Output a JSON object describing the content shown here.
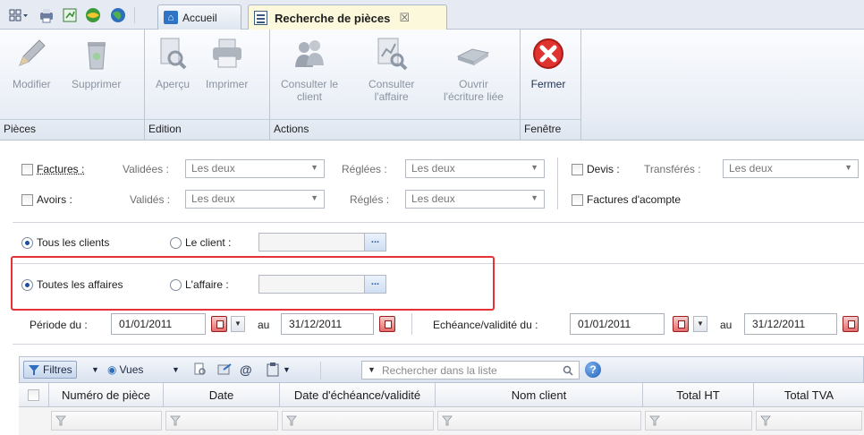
{
  "tabs": {
    "home_label": "Accueil",
    "active_label": "Recherche de pièces",
    "close_symbol": "☒"
  },
  "ribbon": {
    "groups": {
      "pieces": "Pièces",
      "edition": "Edition",
      "actions": "Actions",
      "fenetre": "Fenêtre"
    },
    "buttons": {
      "modifier": "Modifier",
      "supprimer": "Supprimer",
      "apercu": "Aperçu",
      "imprimer": "Imprimer",
      "consulter_client_1": "Consulter le",
      "consulter_client_2": "client",
      "consulter_affaire_1": "Consulter",
      "consulter_affaire_2": "l'affaire",
      "ouvrir_ecriture_1": "Ouvrir",
      "ouvrir_ecriture_2": "l'écriture liée",
      "fermer": "Fermer"
    }
  },
  "filters": {
    "factures": "Factures :",
    "avoirs": "Avoirs :",
    "validees": "Validées :",
    "valides": "Validés :",
    "reglees": "Réglées :",
    "regles": "Réglés :",
    "les_deux": "Les deux",
    "devis": "Devis :",
    "transferes": "Transférés :",
    "factures_acompte": "Factures d'acompte"
  },
  "clients": {
    "tous_clients": "Tous les clients",
    "le_client": "Le client :",
    "toutes_affaires": "Toutes les affaires",
    "l_affaire": "L'affaire :",
    "lookup_btn": "..."
  },
  "periode": {
    "label": "Période du :",
    "start": "01/01/2011",
    "au": "au",
    "end": "31/12/2011",
    "echeance_label": "Echéance/validité du :",
    "ech_start": "01/01/2011",
    "ech_au": "au",
    "ech_end": "31/12/2011"
  },
  "toolbar": {
    "filtres": "Filtres",
    "vues": "Vues",
    "search_placeholder": "Rechercher dans la liste",
    "help": "?"
  },
  "grid": {
    "columns": [
      "Numéro de pièce",
      "Date",
      "Date d'échéance/validité",
      "Nom client",
      "Total HT",
      "Total TVA"
    ]
  },
  "colors": {
    "accent": "#2f73c6",
    "highlight": "#e53238",
    "active_tab": "#fbf8dc"
  }
}
